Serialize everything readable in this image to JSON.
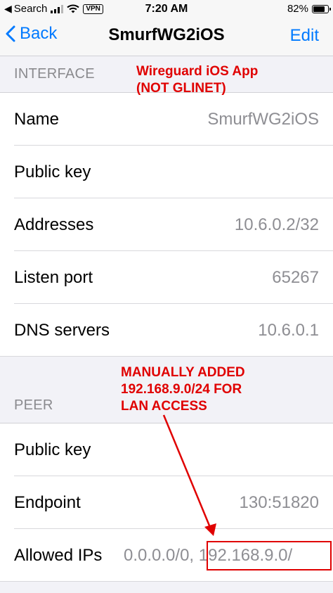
{
  "status_bar": {
    "back_app": "Search",
    "vpn": "VPN",
    "time": "7:20 AM",
    "battery_text": "82%",
    "battery_level": 0.82
  },
  "nav": {
    "back_label": "Back",
    "title": "SmurfWG2iOS",
    "edit_label": "Edit"
  },
  "interface": {
    "header": "INTERFACE",
    "rows": [
      {
        "label": "Name",
        "value": "SmurfWG2iOS"
      },
      {
        "label": "Public key",
        "value": ""
      },
      {
        "label": "Addresses",
        "value": "10.6.0.2/32"
      },
      {
        "label": "Listen port",
        "value": "65267"
      },
      {
        "label": "DNS servers",
        "value": "10.6.0.1"
      }
    ]
  },
  "peer": {
    "header": "PEER",
    "rows": [
      {
        "label": "Public key",
        "value": ""
      },
      {
        "label": "Endpoint",
        "value": "130:51820"
      },
      {
        "label": "Allowed IPs",
        "value": "0.0.0.0/0, 192.168.9.0/"
      }
    ]
  },
  "annotations": {
    "app_note": [
      "Wireguard iOS App",
      "(NOT GLINET)"
    ],
    "manual_note": [
      "MANUALLY ADDED",
      "192.168.9.0/24 FOR",
      "LAN ACCESS"
    ],
    "color": "#e00000"
  },
  "colors": {
    "accent": "#007aff",
    "secondary_text": "#8e8e93",
    "background": "#f2f2f7"
  }
}
